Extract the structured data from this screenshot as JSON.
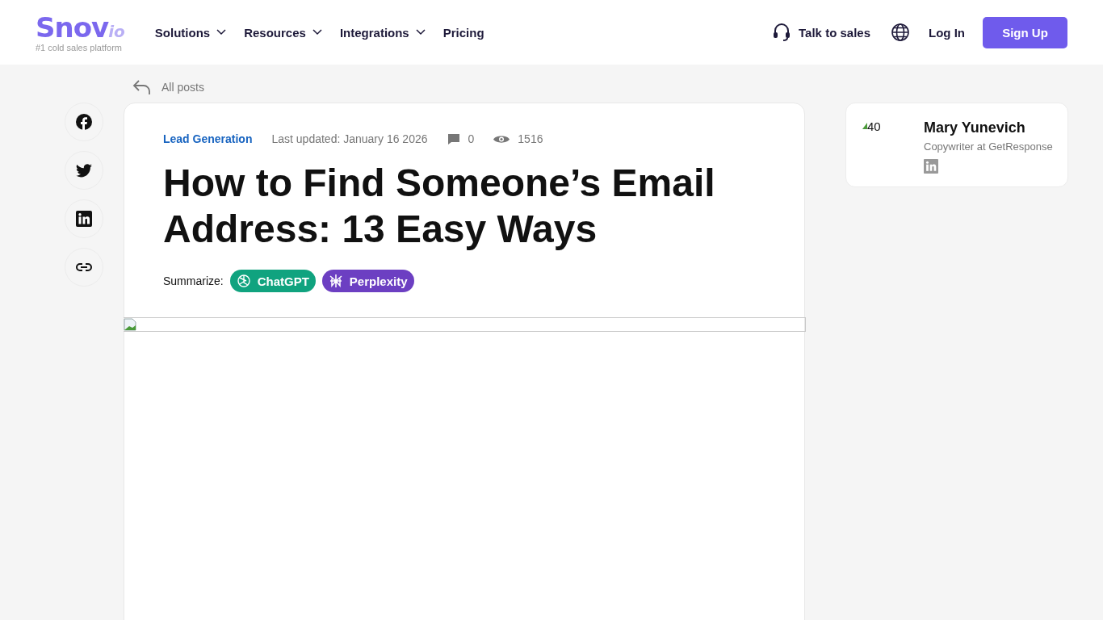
{
  "header": {
    "logo": {
      "name": "Snov",
      "suffix": "io",
      "tagline": "#1 cold sales platform"
    },
    "nav": [
      {
        "label": "Solutions",
        "dropdown": true
      },
      {
        "label": "Resources",
        "dropdown": true
      },
      {
        "label": "Integrations",
        "dropdown": true
      },
      {
        "label": "Pricing",
        "dropdown": false
      }
    ],
    "talk_to_sales": "Talk to sales",
    "login": "Log In",
    "signup": "Sign Up"
  },
  "back_link": "All posts",
  "share": [
    {
      "kind": "facebook"
    },
    {
      "kind": "twitter"
    },
    {
      "kind": "linkedin"
    },
    {
      "kind": "link"
    }
  ],
  "article": {
    "category": "Lead Generation",
    "updated": "Last updated: January 16 2026",
    "comments": "0",
    "views": "1516",
    "title": "How to Find Someone’s Email Address: 13 Easy Ways",
    "summarize_label": "Summarize:",
    "summarize": [
      {
        "kind": "chatgpt",
        "label": "ChatGPT",
        "color": "#10a37f"
      },
      {
        "kind": "perplexity",
        "label": "Perplexity",
        "color": "#6c3fc2"
      }
    ]
  },
  "author": {
    "avatar_alt": "40",
    "name": "Mary Yunevich",
    "role": "Copywriter at GetResponse"
  }
}
